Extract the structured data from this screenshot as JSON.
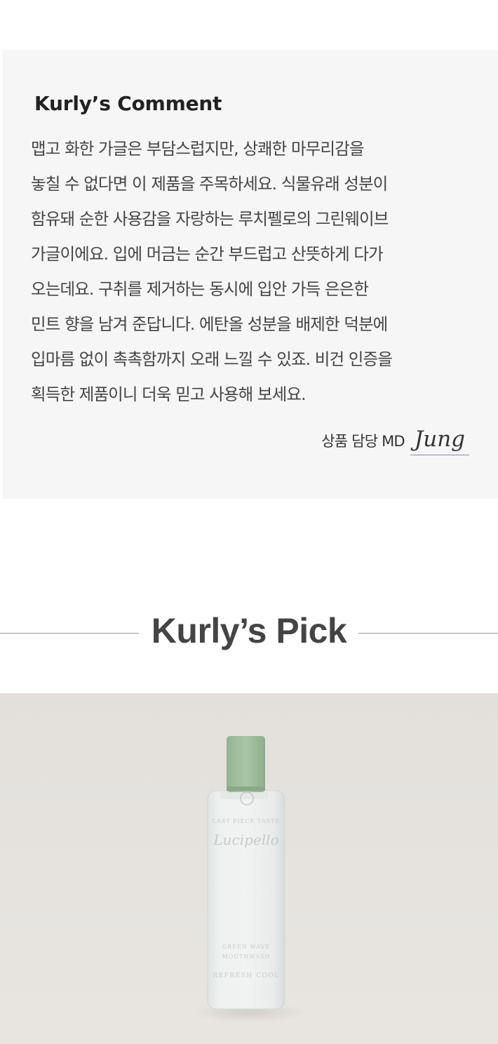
{
  "comment": {
    "title": "Kurly’s Comment",
    "lines": [
      "맵고 화한 가글은 부담스럽지만, 상쾌한 마무리감을",
      "놓칠 수 없다면 이 제품을 주목하세요. 식물유래 성분이",
      "함유돼 순한 사용감을 자랑하는 루치펠로의 그린웨이브",
      "가글이에요. 입에 머금는 순간 부드럽고 산뜻하게 다가",
      "오는데요. 구취를 제거하는 동시에 입안 가득 은은한",
      "민트 향을 남겨 준답니다. 에탄올 성분을 배제한 덕분에",
      "입마름 없이 촉촉함까지 오래 느낄 수 있죠. 비건 인증을",
      "획득한 제품이니 더욱 믿고 사용해 보세요."
    ],
    "signature_label": "상품 담당 MD",
    "signature_name": "Jung"
  },
  "pick": {
    "title": "Kurly’s Pick"
  },
  "product_image": {
    "icon": "mouthwash-bottle",
    "cap_color": "#a7c4a4",
    "bottle_label_lines": [
      "LAST PIECE TASTE",
      "Lucipello",
      "GREEN WAVE",
      "MOUTHWASH",
      "REFRESH COOL"
    ]
  }
}
